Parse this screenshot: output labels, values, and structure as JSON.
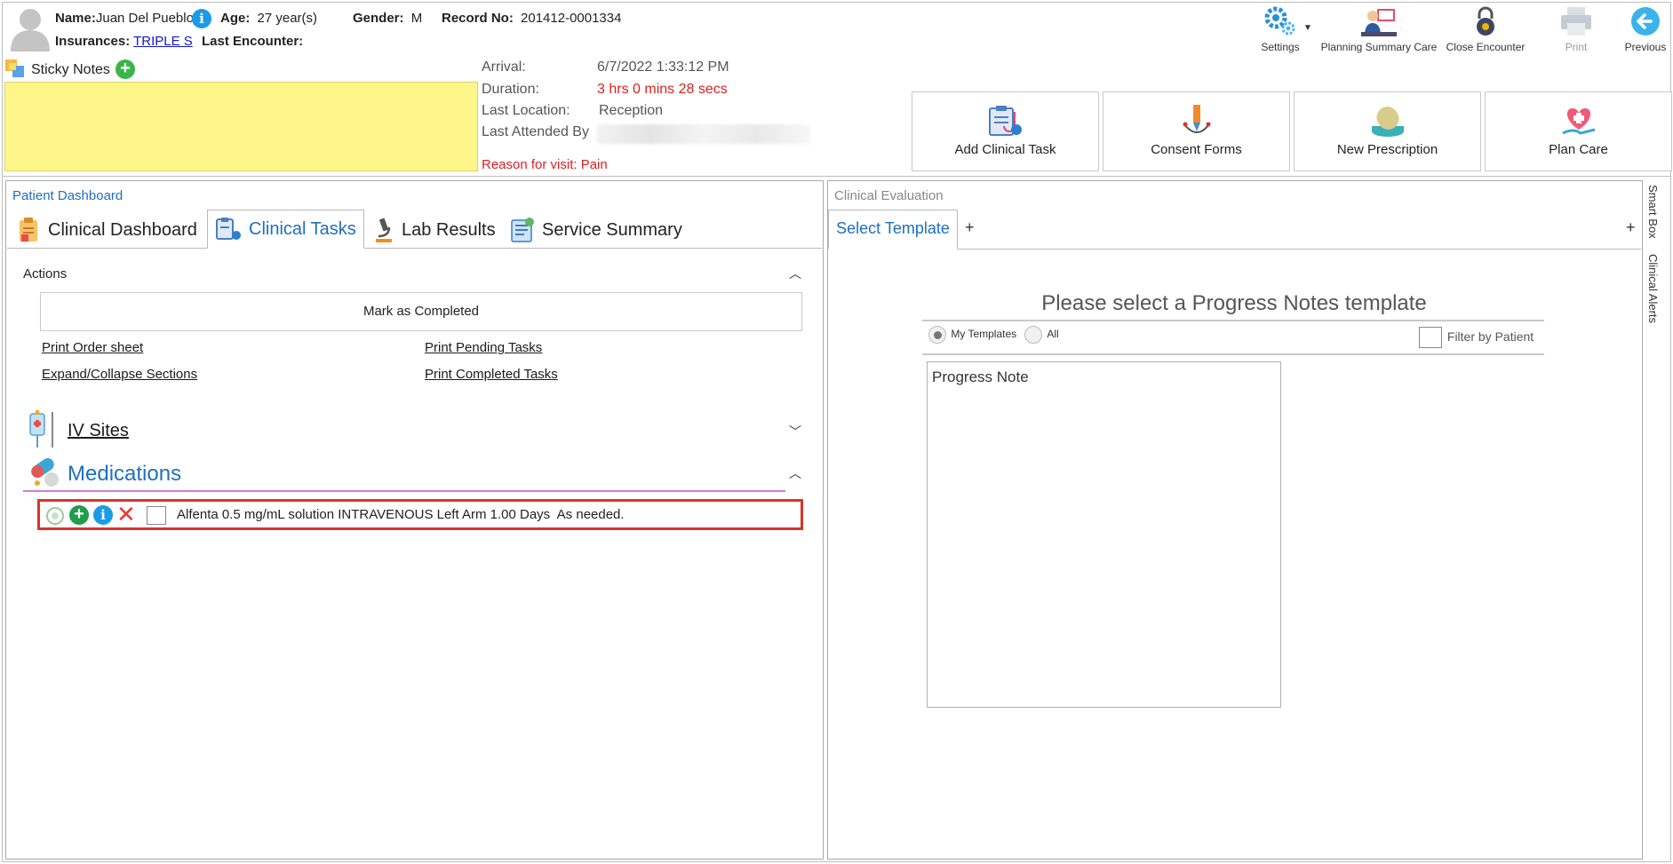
{
  "patient": {
    "name_label": "Name:",
    "name": "Juan Del Pueblo",
    "age_label": "Age:",
    "age": "27 year(s)",
    "gender_label": "Gender:",
    "gender": "M",
    "record_label": "Record No:",
    "record": "201412-0001334",
    "insurances_label": "Insurances:",
    "insurance": "TRIPLE S",
    "last_encounter_label": "Last Encounter:"
  },
  "toolbar": {
    "settings": "Settings",
    "planning": "Planning Summary Care",
    "close_encounter": "Close Encounter",
    "print": "Print",
    "previous": "Previous"
  },
  "sticky_notes": {
    "label": "Sticky Notes"
  },
  "visit": {
    "arrival_label": "Arrival:",
    "arrival": "6/7/2022 1:33:12 PM",
    "duration_label": "Duration:",
    "duration": "3 hrs 0 mins 28 secs",
    "last_location_label": "Last Location:",
    "last_location": "Reception",
    "last_attended_label": "Last Attended By",
    "reason": "Reason for visit: Pain"
  },
  "quick_actions": {
    "add_clinical_task": "Add Clinical Task",
    "consent_forms": "Consent Forms",
    "new_prescription": "New Prescription",
    "plan_care": "Plan Care"
  },
  "dashboard": {
    "title": "Patient Dashboard",
    "tabs": [
      {
        "label": "Clinical Dashboard"
      },
      {
        "label": "Clinical Tasks"
      },
      {
        "label": "Lab Results"
      },
      {
        "label": "Service Summary"
      }
    ],
    "actions_title": "Actions",
    "mark_completed": "Mark as Completed",
    "print_order_sheet": "Print Order sheet",
    "print_pending": "Print Pending Tasks",
    "expand_collapse": "Expand/Collapse Sections",
    "print_completed": "Print Completed Tasks",
    "iv_sites": "IV Sites",
    "medications": "Medications",
    "medication_item": "Alfenta 0.5 mg/mL solution INTRAVENOUS Left Arm 1.00 Days  As needed.",
    "medication_line_color": "#d17bd6"
  },
  "evaluation": {
    "title": "Clinical Evaluation",
    "tab_select_template": "Select Template",
    "add_tab": "+",
    "add_tab_right": "+",
    "prompt": "Please select a Progress Notes template",
    "my_templates": "My Templates",
    "all": "All",
    "filter_by_patient": "Filter by Patient",
    "templates": [
      "Progress Note"
    ]
  },
  "side_tabs": {
    "smart_box": "Smart Box",
    "clinical_alerts": "Clinical Alerts"
  },
  "colors": {
    "accent_blue": "#1e6fbf",
    "sticky_yellow": "#fff68a",
    "alert_red": "#e02020",
    "highlight_border": "#d9342b"
  }
}
